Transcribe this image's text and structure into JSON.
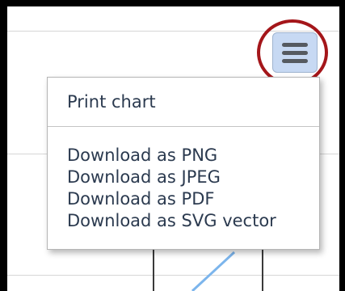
{
  "export_menu": {
    "button_icon": "hamburger-menu-icon",
    "highlight_color": "#a4161a",
    "button_color": "#c7d9f3",
    "items": [
      {
        "label": "Print chart"
      },
      {
        "label": "Download as PNG"
      },
      {
        "label": "Download as JPEG"
      },
      {
        "label": "Download as PDF"
      },
      {
        "label": "Download as SVG vector"
      }
    ]
  },
  "chart": {
    "series_color": "#7cb5ec",
    "axis_line_color": "#3a3a3a"
  }
}
